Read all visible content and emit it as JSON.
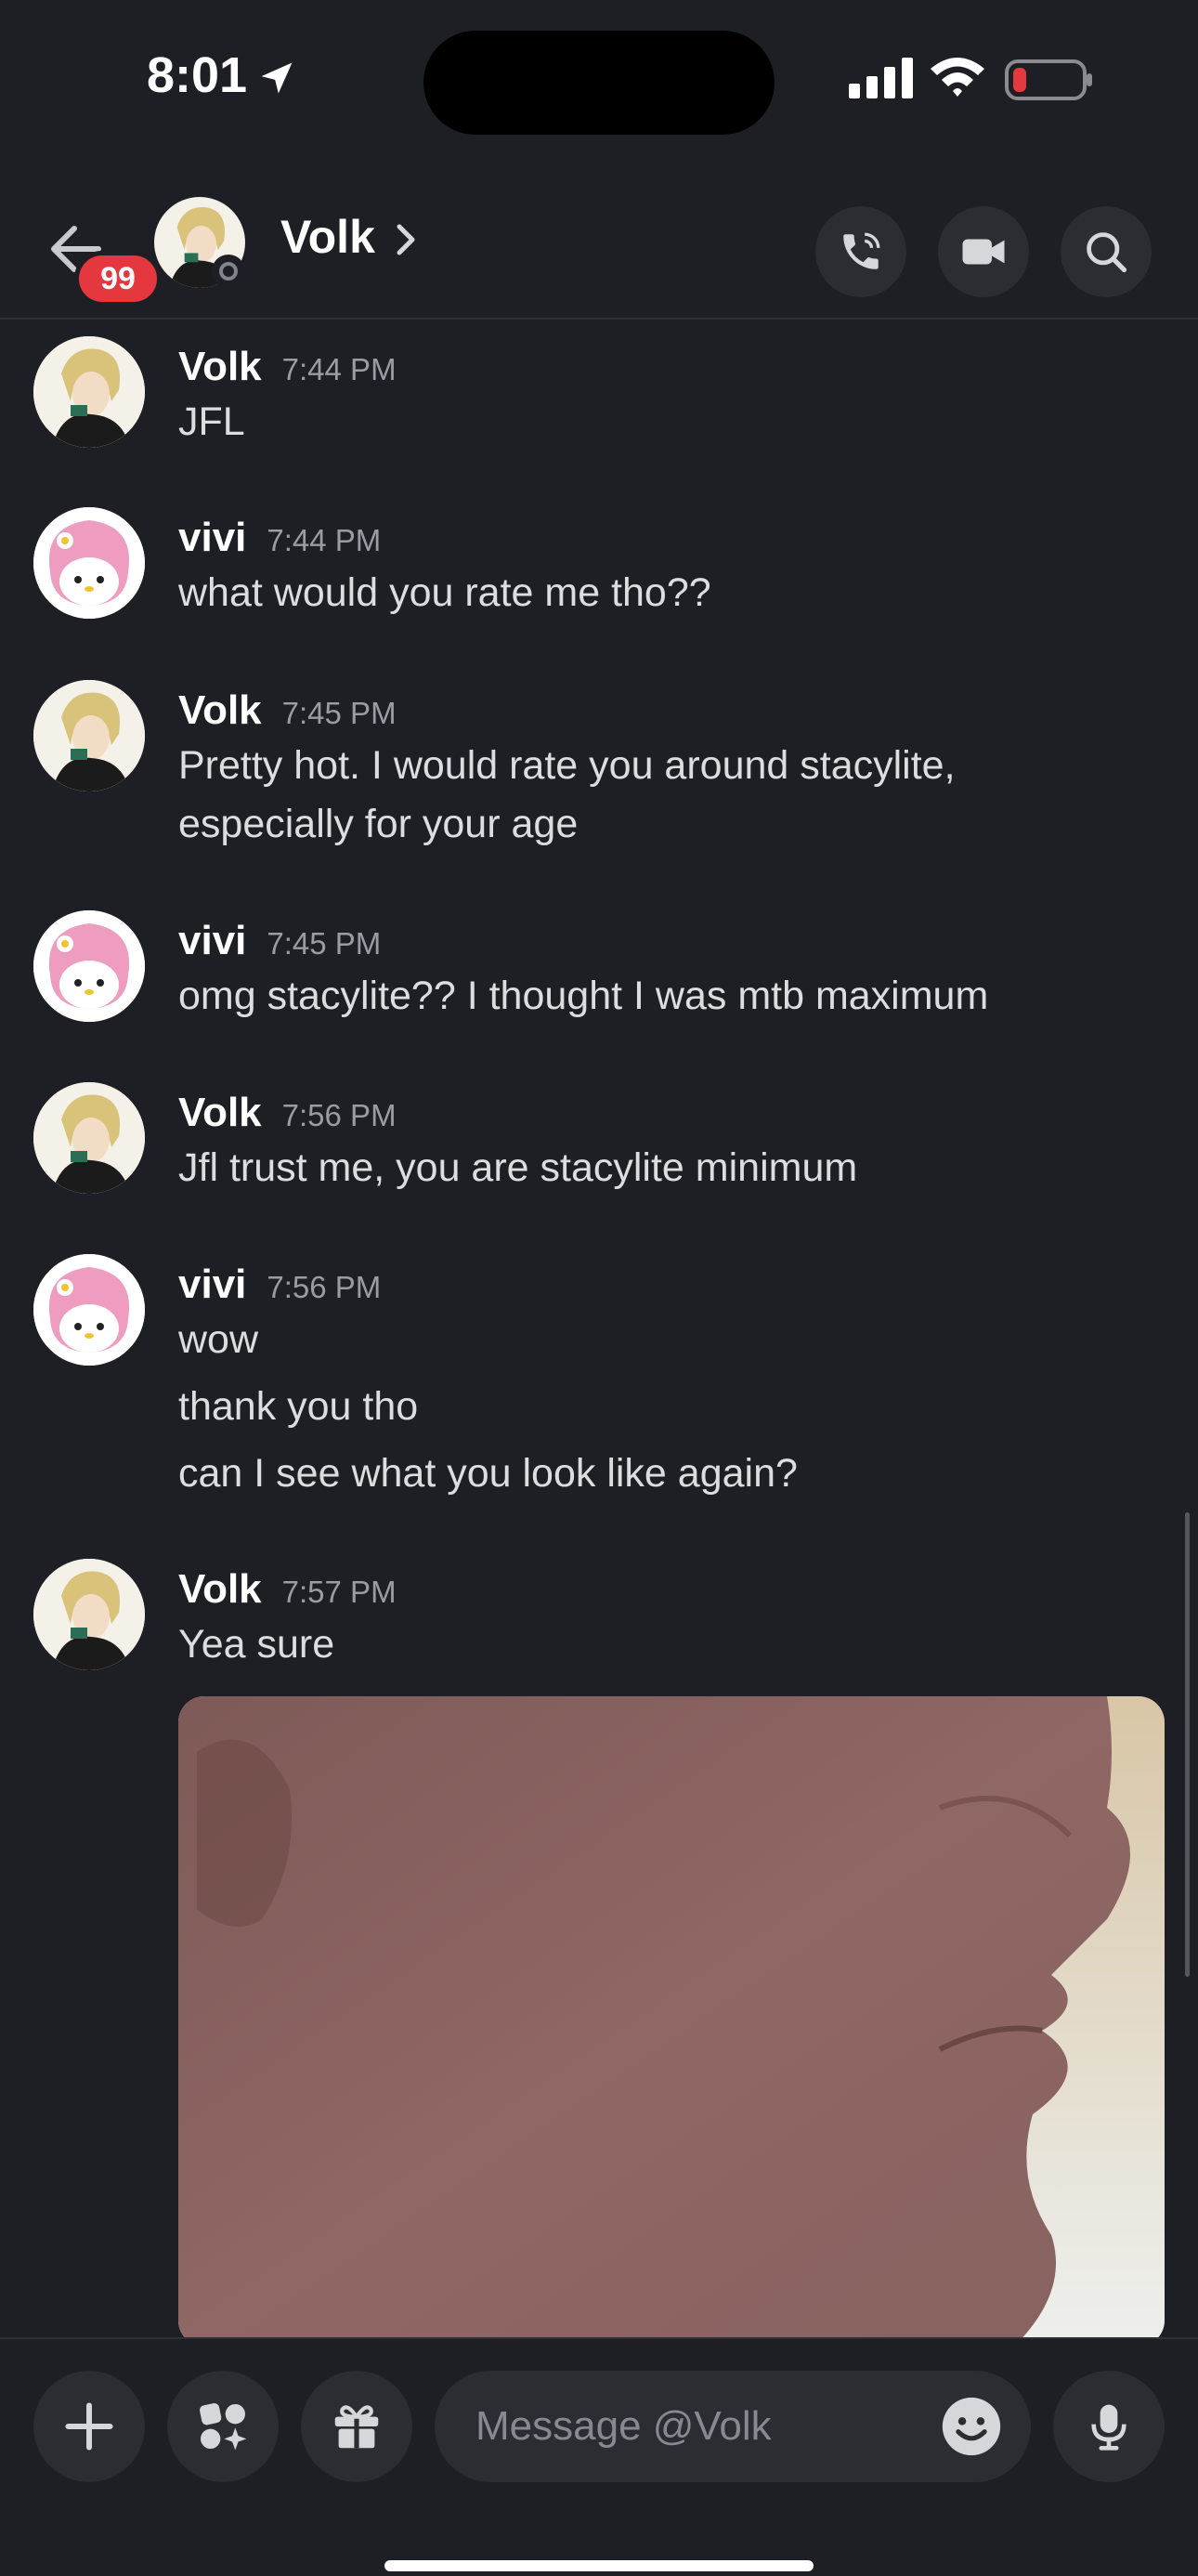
{
  "status_bar": {
    "time": "8:01",
    "icons": [
      "location-arrow-icon",
      "signal-bars-icon",
      "wifi-icon",
      "battery-low-icon"
    ],
    "battery_color": "#e5393d"
  },
  "header": {
    "unread_badge": "99",
    "contact_name": "Volk",
    "icons": [
      "back-arrow-icon",
      "chevron-right-icon",
      "phone-call-icon",
      "video-camera-icon",
      "search-icon"
    ]
  },
  "messages": [
    {
      "author": "Volk",
      "time": "7:44 PM",
      "avatar": "volk",
      "lines": [
        "JFL"
      ]
    },
    {
      "author": "vivi",
      "time": "7:44 PM",
      "avatar": "vivi",
      "lines": [
        "what would you rate me tho??"
      ]
    },
    {
      "author": "Volk",
      "time": "7:45 PM",
      "avatar": "volk",
      "lines": [
        "Pretty hot. I would rate you around stacylite,",
        "especially for your age"
      ]
    },
    {
      "author": "vivi",
      "time": "7:45 PM",
      "avatar": "vivi",
      "lines": [
        "omg stacylite?? I thought I was mtb maximum"
      ]
    },
    {
      "author": "Volk",
      "time": "7:56 PM",
      "avatar": "volk",
      "lines": [
        "Jfl trust me, you are stacylite minimum"
      ]
    },
    {
      "author": "vivi",
      "time": "7:56 PM",
      "avatar": "vivi",
      "lines": [
        "wow",
        "thank you tho",
        "can I see what you look like again?"
      ]
    },
    {
      "author": "Volk",
      "time": "7:57 PM",
      "avatar": "volk",
      "lines": [
        "Yea sure"
      ],
      "attachment": "photo"
    }
  ],
  "composer": {
    "placeholder": "Message @Volk",
    "icons": [
      "plus-icon",
      "apps-icon",
      "gift-icon",
      "emoji-icon",
      "microphone-icon"
    ]
  },
  "colors": {
    "background": "#1e1f24",
    "button_bg": "#2b2d33",
    "badge": "#e4383e",
    "timestamp": "#9b9ca3"
  }
}
